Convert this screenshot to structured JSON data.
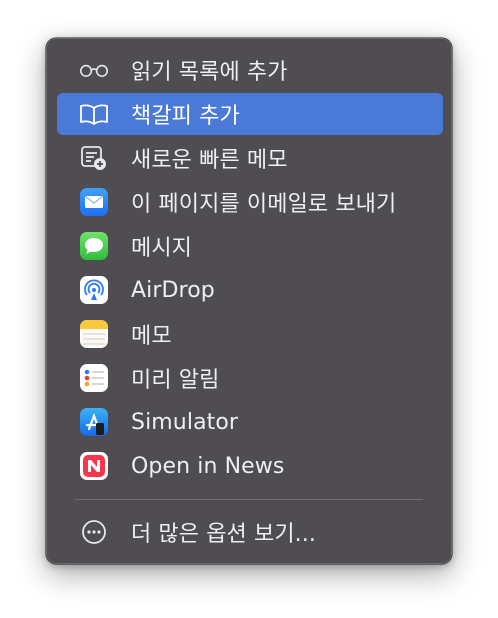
{
  "menu": {
    "items": [
      {
        "label": "읽기 목록에 추가",
        "icon": "reading-glasses-icon"
      },
      {
        "label": "책갈피 추가",
        "icon": "book-icon",
        "highlighted": true
      },
      {
        "label": "새로운 빠른 메모",
        "icon": "quick-note-icon"
      },
      {
        "label": "이 페이지를 이메일로 보내기",
        "icon": "mail-icon"
      },
      {
        "label": "메시지",
        "icon": "messages-icon"
      },
      {
        "label": "AirDrop",
        "icon": "airdrop-icon"
      },
      {
        "label": "메모",
        "icon": "notes-icon"
      },
      {
        "label": "미리 알림",
        "icon": "reminders-icon"
      },
      {
        "label": "Simulator",
        "icon": "simulator-icon"
      },
      {
        "label": "Open in News",
        "icon": "news-icon"
      }
    ],
    "more": {
      "label": "더 많은 옵션 보기...",
      "icon": "more-ellipsis-icon"
    }
  },
  "colors": {
    "menu_bg": "#4f4d52",
    "highlight": "#4a79d8",
    "text": "#efeef0"
  }
}
